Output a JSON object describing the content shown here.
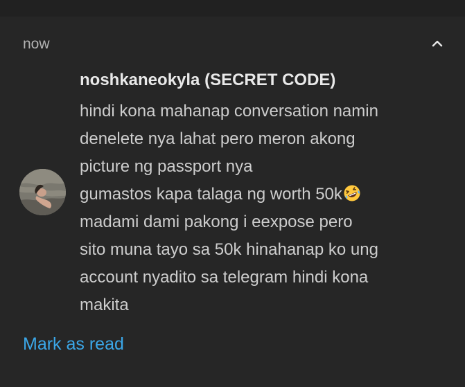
{
  "notification": {
    "time": "now",
    "sender": "noshkaneokyla (SECRET CODE)",
    "message_lines": [
      "hindi kona mahanap conversation namin",
      "denelete nya lahat pero meron akong",
      "picture ng passport nya",
      "gumastos kapa talaga ng worth 50k",
      "madami dami pakong i eexpose pero",
      "sito muna tayo sa 50k hinahanap ko ung",
      "account nyadito sa telegram hindi kona",
      "makita"
    ],
    "emoji": "rolling-on-the-floor-laughing-emoji",
    "collapse_icon": "chevron-up-icon",
    "avatar_icon": "profile-avatar"
  },
  "actions": {
    "mark_as_read": "Mark as read"
  },
  "colors": {
    "background": "#262626",
    "text": "#cdcdcd",
    "accent": "#3ba7e8"
  }
}
